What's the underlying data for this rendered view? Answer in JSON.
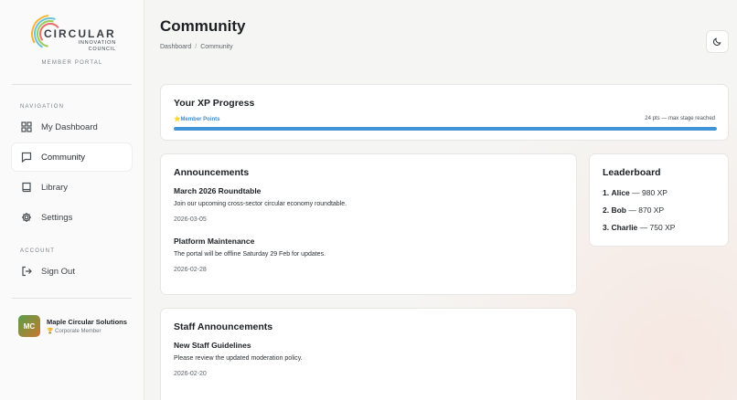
{
  "brand": {
    "logo_word": "CIRCULAR",
    "logo_sub_1": "INNOVATION",
    "logo_sub_2": "COUNCIL",
    "portal_label": "MEMBER PORTAL"
  },
  "sidebar": {
    "navigation_label": "NAVIGATION",
    "nav_items": [
      {
        "label": "My Dashboard",
        "icon": "grid-icon"
      },
      {
        "label": "Community",
        "icon": "chat-icon",
        "active": true
      },
      {
        "label": "Library",
        "icon": "book-icon"
      },
      {
        "label": "Settings",
        "icon": "gear-icon"
      }
    ],
    "account_label": "ACCOUNT",
    "sign_out": {
      "label": "Sign Out",
      "icon": "sign-out-icon"
    },
    "org": {
      "initials": "MC",
      "name": "Maple Circular Solutions",
      "tier": "Corporate Member",
      "tier_icon": "trophy-icon"
    }
  },
  "header": {
    "title": "Community",
    "breadcrumb": [
      "Dashboard",
      "Community"
    ],
    "theme_toggle_icon": "moon-icon"
  },
  "xp": {
    "title": "Your XP Progress",
    "points_label": "Member Points",
    "points_icon": "star-icon",
    "status": "24 pts — max stage reached",
    "progress": 1.0,
    "bar_color": "#3f93d6"
  },
  "announcements": {
    "title": "Announcements",
    "posts": [
      {
        "title": "March 2026 Roundtable",
        "body": "Join our upcoming cross-sector circular economy roundtable.",
        "date": "2026-03-05"
      },
      {
        "title": "Platform Maintenance",
        "body": "The portal will be offline Saturday 29 Feb for updates.",
        "date": "2026-02-28"
      }
    ]
  },
  "staff_announcements": {
    "title": "Staff Announcements",
    "posts": [
      {
        "title": "New Staff Guidelines",
        "body": "Please review the updated moderation policy.",
        "date": "2026-02-20"
      }
    ]
  },
  "leaderboard": {
    "title": "Leaderboard",
    "entries": [
      {
        "rank": "1.",
        "name": "Alice",
        "score": "— 980 XP"
      },
      {
        "rank": "2.",
        "name": "Bob",
        "score": "— 870 XP"
      },
      {
        "rank": "3.",
        "name": "Charlie",
        "score": "— 750 XP"
      }
    ]
  }
}
